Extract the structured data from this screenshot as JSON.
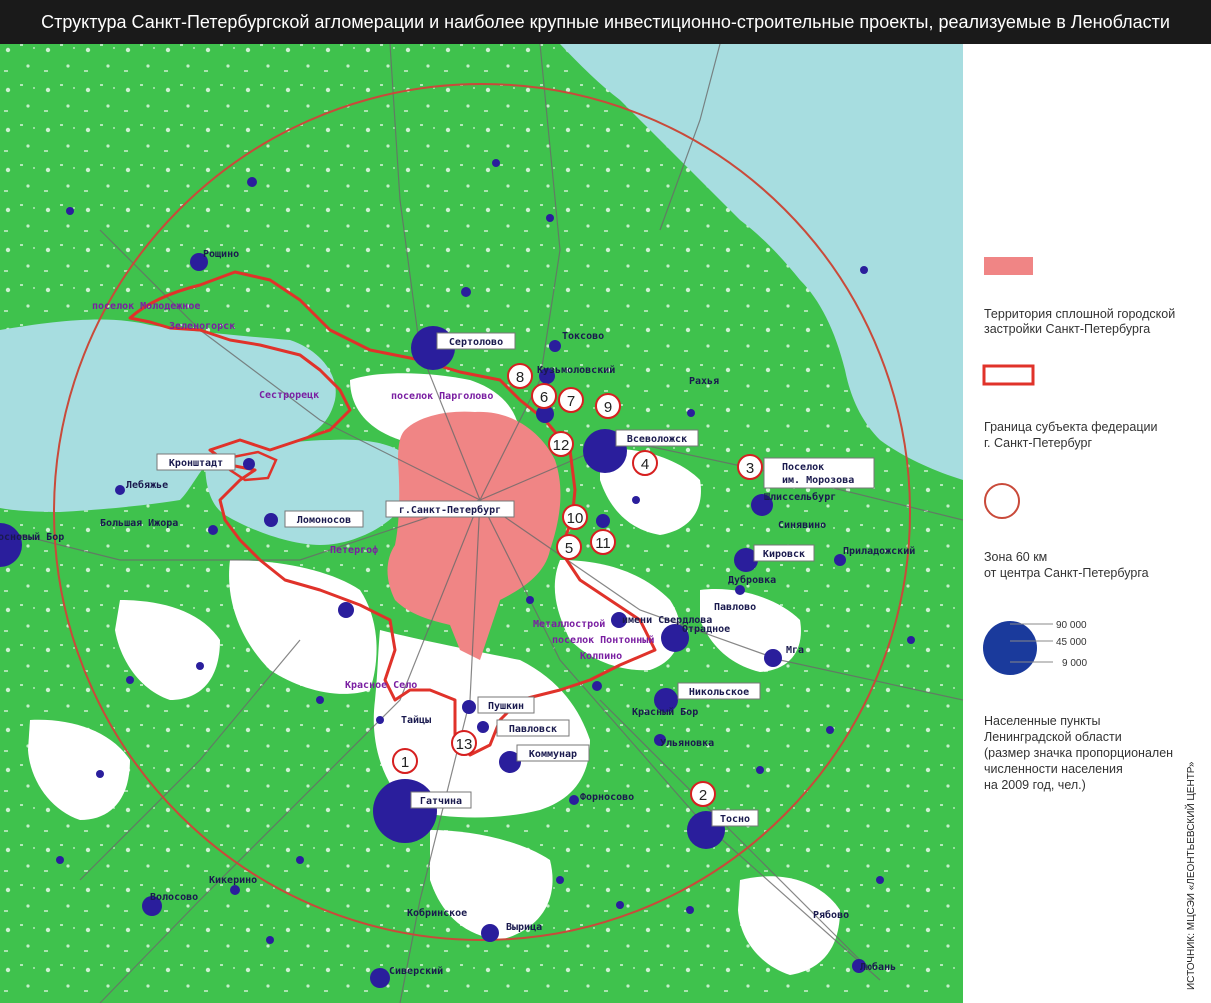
{
  "title": "Структура Санкт-Петербургской агломерации и наиболее крупные инвестиционно-строительные проекты, реализуемые в Ленобласти",
  "colors": {
    "forest": "#3fc24d",
    "water": "#a7dde0",
    "city_fill": "#f08585",
    "border": "#e0322a",
    "zone_circle": "#c94a3a",
    "settlement": "#2a1e9c"
  },
  "legend": {
    "city_territory": "Территория сплошной городской застройки Санкт-Петербурга",
    "border_line1": "Граница субъекта федерации",
    "border_line2": "г. Санкт-Петербург",
    "zone_line1": "Зона 60 км",
    "zone_line2": "от центра Санкт-Петербурга",
    "pop_90000": "90 000",
    "pop_45000": "45 000",
    "pop_9000": "9 000",
    "settl_line1": "Населенные пункты",
    "settl_line2": "Ленинградской области",
    "settl_line3": "(размер значка пропорционален",
    "settl_line4": "численности населения",
    "settl_line5": "на 2009 год, чел.)"
  },
  "source": "ИСТОЧНИК: МЦСЭИ «ЛЕОНТЬЕВСКИЙ ЦЕНТР»",
  "boxed_labels": {
    "sertolovo": "Сертолово",
    "vsevolozhsk": "Всеволожск",
    "kronshtadt": "Кронштадт",
    "lomonosov": "Ломоносов",
    "spb": "г.Санкт-Петербург",
    "morozova_1": "Поселок",
    "morozova_2": "им. Морозова",
    "kirovsk": "Кировск",
    "nikolskoe": "Никольское",
    "pushkin": "Пушкин",
    "pavlovsk": "Павловск",
    "kommunar": "Коммунар",
    "gatchina": "Гатчина",
    "tosno": "Тосно"
  },
  "plain_labels": {
    "roshino": "Рощино",
    "toksovo": "Токсово",
    "kuzmolovsky": "Кузьмоловский",
    "rakhya": "Рахья",
    "lebyazhye": "Лебяжье",
    "sosnovy_bor": "Сосновый Бор",
    "bolshaya_izhora": "Большая Ижора",
    "shlisselburg": "Шлиссельбург",
    "sinyavino": "Синявино",
    "priladozhsky": "Приладожский",
    "dubrovka": "Дубровка",
    "pavlovo": "Павлово",
    "imeni_sverdlova": "имени Свердлова",
    "otradnoe": "Отрадное",
    "mga": "Мга",
    "krasny_bor": "Красный Бор",
    "ulyanovka": "Ульяновка",
    "taitsy": "Тайцы",
    "fornosovo": "Форносово",
    "kikerino": "Кикерино",
    "volosovo": "Волосово",
    "kobrinskoe": "Кобринское",
    "vyritsa": "Вырица",
    "siversky": "Сиверский",
    "ryabovo": "Рябово",
    "lyuban": "Любань"
  },
  "purple_labels": {
    "molodezhnoe": "поселок Молодежное",
    "zelenogorsk": "Зеленогорск",
    "sestroretsk": "Сестрорецк",
    "pargolovo": "поселок Парголово",
    "petergof": "Петергоф",
    "krasnoe_selo": "Красное Село",
    "metallostroy": "Металлострой",
    "pontonny": "поселок Понтонный",
    "kolpino": "Колпино"
  },
  "project_numbers": [
    "1",
    "2",
    "3",
    "4",
    "5",
    "6",
    "7",
    "8",
    "9",
    "10",
    "11",
    "12",
    "13"
  ]
}
